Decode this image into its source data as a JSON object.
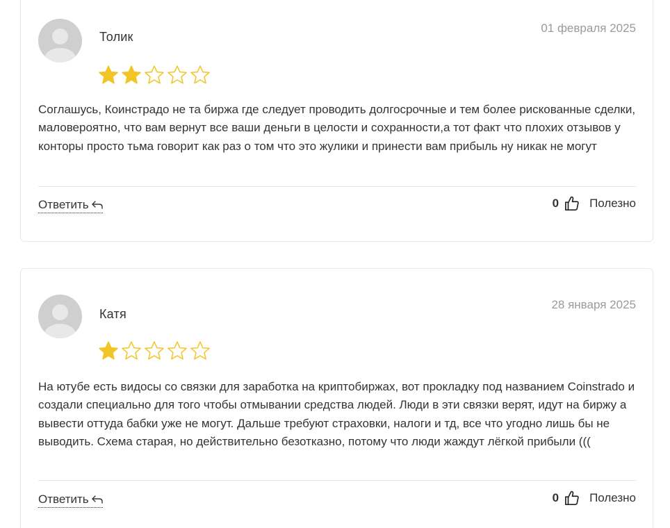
{
  "colors": {
    "star_filled": "#f2c526",
    "star_empty": "#f2c526",
    "date": "#9a9a9a",
    "text": "#333333"
  },
  "reviews": [
    {
      "author": "Толик",
      "date": "01 февраля 2025",
      "rating": 2,
      "max_rating": 5,
      "text": "Соглашусь, Коинстрадо не та биржа где следует проводить долгосрочные и тем более рискованные сделки, маловероятно, что вам вернут все ваши деньги в целости и сохранности,а тот факт что плохих отзывов у конторы просто тьма говорит как раз о том что это жулики и принести вам прибыль ну никак не могут",
      "reply_label": "Ответить",
      "helpful_count": "0",
      "helpful_label": "Полезно"
    },
    {
      "author": "Катя",
      "date": "28 января 2025",
      "rating": 1,
      "max_rating": 5,
      "text": "На ютубе есть видосы со связки для заработка на криптобиржах, вот прокладку под названием Coinstrado и создали специально для того чтобы отмывании средства людей. Люди в эти связки верят, идут на биржу а вывести оттуда бабки уже не могут. Дальше требуют страховки, налоги и тд, все что угодно лишь бы не выводить. Схема старая, но действительно безотказно, потому что люди жаждут лёгкой прибыли (((",
      "reply_label": "Ответить",
      "helpful_count": "0",
      "helpful_label": "Полезно"
    }
  ]
}
